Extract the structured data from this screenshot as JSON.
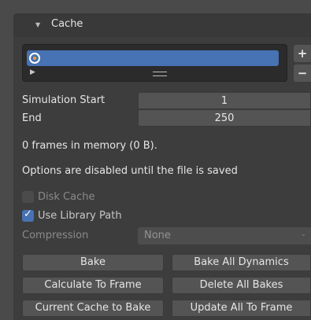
{
  "panel": {
    "title": "Cache",
    "collapse_icon": "triangle-down-icon"
  },
  "list": {
    "item_icon": "cache-item-icon",
    "add_label": "+",
    "remove_label": "−"
  },
  "fields": {
    "simulation_start_label": "Simulation Start",
    "simulation_start_value": "1",
    "end_label": "End",
    "end_value": "250"
  },
  "info": {
    "frames_in_memory": "0 frames in memory (0 B).",
    "options_disabled": "Options are disabled until the file is saved"
  },
  "options": {
    "disk_cache_label": "Disk Cache",
    "disk_cache_checked": false,
    "use_library_path_label": "Use Library Path",
    "use_library_path_checked": true,
    "compression_label": "Compression",
    "compression_value": "None"
  },
  "buttons": {
    "bake": "Bake",
    "bake_all_dynamics": "Bake All Dynamics",
    "calculate_to_frame": "Calculate To Frame",
    "delete_all_bakes": "Delete All Bakes",
    "current_cache_to_bake": "Current Cache to Bake",
    "update_all_to_frame": "Update All To Frame"
  },
  "colors": {
    "accent": "#4772b3",
    "panel_bg": "#3d3d3d",
    "button_bg": "#545454"
  }
}
